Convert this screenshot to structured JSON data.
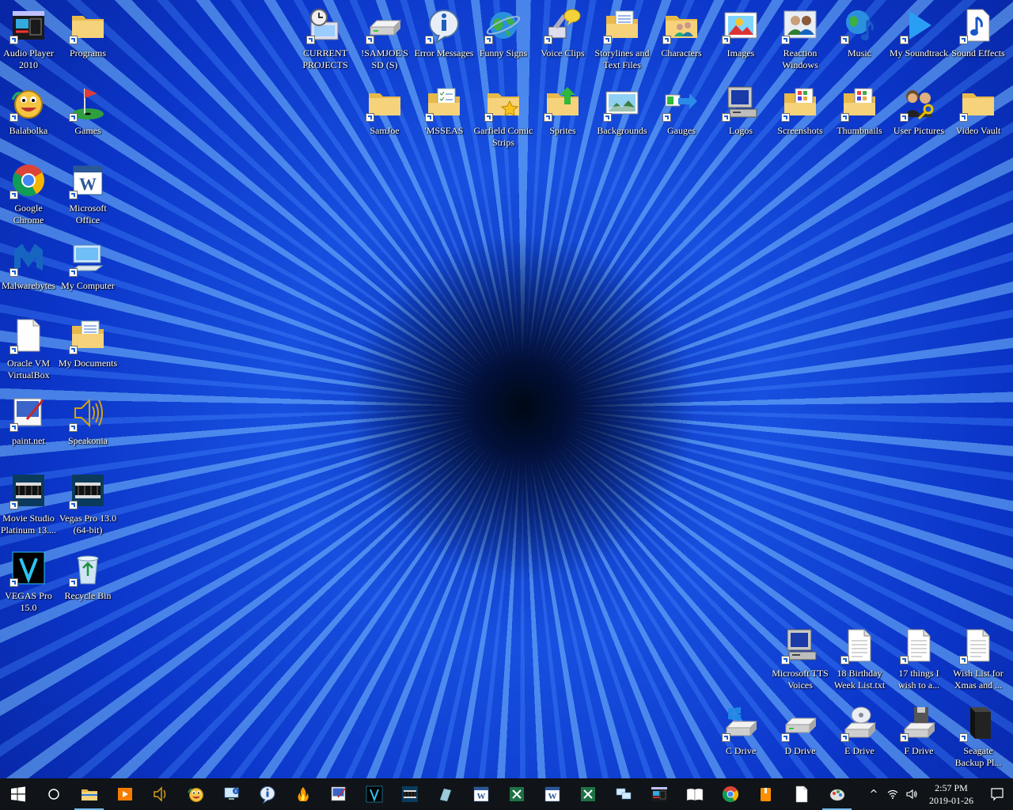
{
  "desktop": {
    "left_icons": [
      {
        "label": "Audio Player 2010",
        "icon": "audio-player-icon"
      },
      {
        "label": "Programs",
        "icon": "folder-icon"
      },
      {
        "label": "Balabolka",
        "icon": "balabolka-icon"
      },
      {
        "label": "Games",
        "icon": "golf-flag-icon"
      },
      {
        "label": "Google Chrome",
        "icon": "chrome-icon"
      },
      {
        "label": "Microsoft Office",
        "icon": "word-icon"
      },
      {
        "label": "Malwarebytes",
        "icon": "malwarebytes-icon"
      },
      {
        "label": "My Computer",
        "icon": "computer-icon"
      },
      {
        "label": "Oracle VM VirtualBox",
        "icon": "blank-file-icon"
      },
      {
        "label": "My Documents",
        "icon": "documents-folder-icon"
      },
      {
        "label": "paint.net",
        "icon": "paintnet-icon"
      },
      {
        "label": "Speakonia",
        "icon": "speaker-icon"
      },
      {
        "label": "Movie Studio Platinum 13....",
        "icon": "film-icon"
      },
      {
        "label": "Vegas Pro 13.0 (64-bit)",
        "icon": "film-icon"
      },
      {
        "label": "VEGAS Pro 15.0",
        "icon": "vegas-icon"
      },
      {
        "label": "Recycle Bin",
        "icon": "recycle-bin-icon"
      }
    ],
    "top_row_1": [
      {
        "label": "CURRENT PROJECTS",
        "icon": "clock-folder-icon"
      },
      {
        "label": "!SAMJOE'S SD (S)",
        "icon": "drive-icon"
      },
      {
        "label": "Error Messages",
        "icon": "info-icon"
      },
      {
        "label": "Funny Signs",
        "icon": "globe-icon"
      },
      {
        "label": "Voice Clips",
        "icon": "voice-icon"
      },
      {
        "label": "Storylines and Text Files",
        "icon": "documents-folder-icon"
      },
      {
        "label": "Characters",
        "icon": "users-folder-icon"
      },
      {
        "label": "Images",
        "icon": "images-icon"
      },
      {
        "label": "Reaction Windows",
        "icon": "users-icon"
      },
      {
        "label": "Music",
        "icon": "music-globe-icon"
      },
      {
        "label": "My Soundtrack",
        "icon": "play-icon"
      },
      {
        "label": "Sound Effects",
        "icon": "music-file-icon"
      }
    ],
    "top_row_2": [
      {
        "label": "SamJoe",
        "icon": "folder-icon"
      },
      {
        "label": "'MSSEAS",
        "icon": "checklist-folder-icon"
      },
      {
        "label": "Garfield Comic Strips",
        "icon": "star-folder-icon"
      },
      {
        "label": "Sprites",
        "icon": "upload-folder-icon"
      },
      {
        "label": "Backgrounds",
        "icon": "landscape-icon"
      },
      {
        "label": "Gauges",
        "icon": "gauge-arrow-icon"
      },
      {
        "label": "Logos",
        "icon": "old-computer-icon"
      },
      {
        "label": "Screenshots",
        "icon": "grid-folder-icon"
      },
      {
        "label": "Thumbnails",
        "icon": "grid-folder-icon"
      },
      {
        "label": "User Pictures",
        "icon": "key-users-icon"
      },
      {
        "label": "Video Vault",
        "icon": "folder-icon"
      }
    ],
    "bottom_files": [
      {
        "label": "Microsoft TTS Voices",
        "icon": "old-computer-icon"
      },
      {
        "label": "18 Birthday Week List.txt",
        "icon": "text-file-icon"
      },
      {
        "label": "17 things I wish to a...",
        "icon": "text-file-icon"
      },
      {
        "label": "Wish List for Xmas and ...",
        "icon": "text-file-icon"
      }
    ],
    "drives": [
      {
        "label": "C Drive",
        "icon": "windows-drive-icon"
      },
      {
        "label": "D Drive",
        "icon": "drive-icon"
      },
      {
        "label": "E Drive",
        "icon": "cd-drive-icon"
      },
      {
        "label": "F Drive",
        "icon": "floppy-drive-icon"
      },
      {
        "label": "Seagate Backup Pl...",
        "icon": "external-drive-icon"
      }
    ]
  },
  "taskbar": {
    "start_icon": "windows-start-icon",
    "apps": [
      "search-circle-icon",
      "file-explorer-icon",
      "media-player-icon",
      "speakonia-icon",
      "balabolka-icon",
      "computer-info-icon",
      "info-icon",
      "fire-icon",
      "paintnet-icon",
      "vegas-icon",
      "film-icon",
      "glass-icon",
      "word-icon",
      "excel-icon",
      "word-icon",
      "excel-icon",
      "network-icon",
      "audio-player-icon",
      "book-icon",
      "chrome-icon",
      "package-icon",
      "blank-file-icon",
      "paint-icon"
    ],
    "clock_time": "2:57 PM",
    "clock_date": "2019-01-26",
    "tray_up": "^",
    "colors": {
      "taskbar": "#101418",
      "accent": "#76b9ed"
    }
  }
}
